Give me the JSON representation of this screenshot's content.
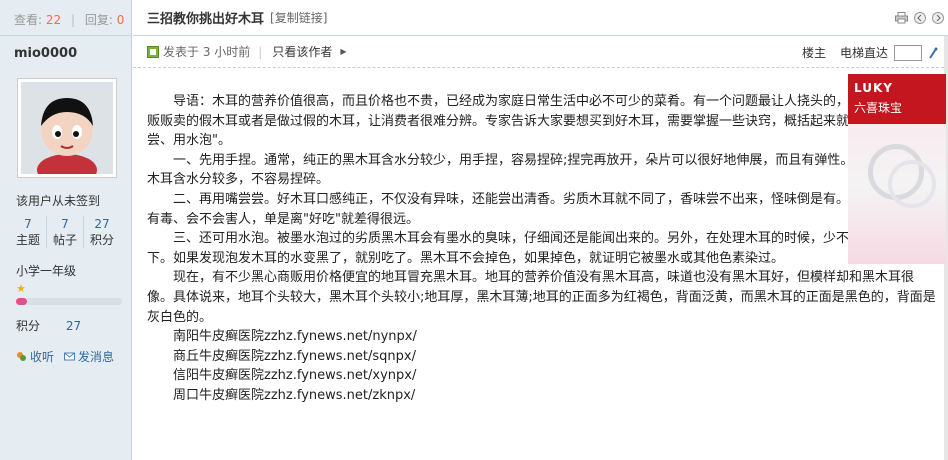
{
  "stats": {
    "views_label": "查看:",
    "views": "22",
    "replies_label": "回复:",
    "replies": "0"
  },
  "user": {
    "name": "mio0000",
    "signin": "该用户从未签到",
    "stats": [
      {
        "value": "7",
        "label": "主题"
      },
      {
        "value": "7",
        "label": "帖子"
      },
      {
        "value": "27",
        "label": "积分"
      }
    ],
    "grade": "小学一年级",
    "progress": 0.1,
    "points_label": "积分",
    "points": "27",
    "favorite": "收听",
    "message": "发消息"
  },
  "thread": {
    "title": "三招教你挑出好木耳",
    "copy_link": "[复制链接]"
  },
  "meta": {
    "posted": "发表于 3 小时前",
    "only_author": "只看该作者",
    "floor": "楼主",
    "lift": "电梯直达"
  },
  "ad": {
    "brand": "LUKY",
    "subtitle": "六喜珠宝"
  },
  "content": {
    "paragraphs": [
      "导语：木耳的营养价值很高，而且价格也不贵，已经成为家庭日常生活中必不可少的菜肴。有一个问题最让人挠头的，有一些不法商贩贩卖的假木耳或者是做过假的木耳，让消费者很难分辨。专家告诉大家要想买到好木耳，需要掌握一些诀窍，概括起来就是\"手捏、口尝、用水泡\"。",
      "一、先用手捏。通常，纯正的黑木耳含水分较少，用手捏，容易捏碎;捏完再放开，朵片可以很好地伸展，而且有弹性。但被浸泡过的木耳含水分较多，不容易捏碎。",
      "二、再用嘴尝尝。好木耳口感纯正，不仅没有异味，还能尝出清香。劣质木耳就不同了，香味尝不出来，怪味倒是有。先不说它有没有毒、会不会害人，单是离\"好吃\"就差得很远。",
      "三、还可用水泡。被墨水泡过的劣质黑木耳会有墨水的臭味，仔细闻还是能闻出来的。另外，在处理木耳的时候，少不了用水泡发一下。如果发现泡发木耳的水变黑了，就别吃了。黑木耳不会掉色，如果掉色，就证明它被墨水或其他色素染过。",
      "现在，有不少黑心商贩用价格便宜的地耳冒充黑木耳。地耳的营养价值没有黑木耳高，味道也没有黑木耳好，但模样却和黑木耳很像。具体说来，地耳个头较大，黑木耳个头较小;地耳厚，黑木耳薄;地耳的正面多为红褐色，背面泛黄，而黑木耳的正面是黑色的，背面是灰白色的。"
    ],
    "links": [
      "南阳牛皮癣医院zzhz.fynews.net/nynpx/",
      "商丘牛皮癣医院zzhz.fynews.net/sqnpx/",
      "信阳牛皮癣医院zzhz.fynews.net/xynpx/",
      "周口牛皮癣医院zzhz.fynews.net/zknpx/"
    ]
  }
}
